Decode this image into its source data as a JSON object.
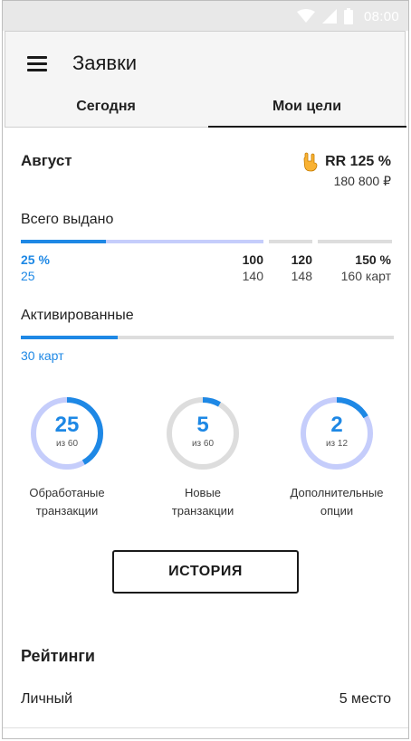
{
  "status_bar": {
    "time": "08:00",
    "icons": [
      "wifi-icon",
      "cellular-signal-icon",
      "battery-icon"
    ]
  },
  "app_bar": {
    "title": "Заявки",
    "tabs": [
      {
        "label": "Сегодня",
        "selected": false
      },
      {
        "label": "Мои цели",
        "selected": true
      }
    ]
  },
  "summary": {
    "month": "Август",
    "rr_label": "RR 125 %",
    "rr_amount": "180 800 ₽",
    "rr_icon": "rock-hand-icon"
  },
  "total_issued": {
    "title": "Всего выдано",
    "progress_fraction_of_first_segment": 0.35,
    "ticks": [
      {
        "percent": "25 %",
        "value": "25"
      },
      {
        "percent": "100",
        "value": "140"
      },
      {
        "percent": "120",
        "value": "148"
      },
      {
        "percent": "150 %",
        "value": "160 карт"
      }
    ]
  },
  "activated": {
    "title": "Активированные",
    "progress_fraction": 0.26,
    "value": "30 карт"
  },
  "metrics": [
    {
      "number": "25",
      "of": "из 60",
      "label_line1": "Обработаные",
      "label_line2": "транзакции",
      "fraction": 0.4167,
      "track_color": "#c5cdfb",
      "fill_color": "#1e88e5"
    },
    {
      "number": "5",
      "of": "из 60",
      "label_line1": "Новые",
      "label_line2": "транзакции",
      "fraction": 0.0833,
      "track_color": "#dddddd",
      "fill_color": "#1e88e5"
    },
    {
      "number": "2",
      "of": "из 12",
      "label_line1": "Дополнительные",
      "label_line2": "опции",
      "fraction": 0.1667,
      "track_color": "#c5cdfb",
      "fill_color": "#1e88e5"
    }
  ],
  "history_button": "ИСТОРИЯ",
  "ratings": {
    "title": "Рейтинги",
    "rows": [
      {
        "label": "Личный",
        "value": "5 место"
      }
    ]
  },
  "colors": {
    "accent": "#1e88e5",
    "light_track": "#c5cdfb",
    "grey_track": "#dddddd"
  }
}
